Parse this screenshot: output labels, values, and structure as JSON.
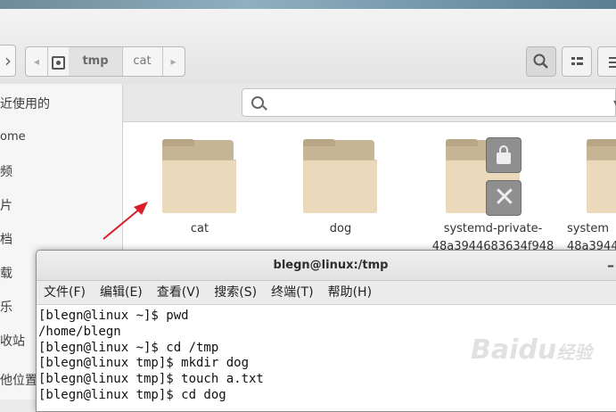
{
  "desktop": {
    "top_label": ""
  },
  "pathbar": {
    "segments": [
      "tmp",
      "cat"
    ]
  },
  "search": {
    "placeholder": ""
  },
  "sidebar": {
    "items": [
      "近使用的",
      "ome",
      "频",
      "片",
      "档",
      "载",
      "乐",
      "收站",
      "他位置"
    ]
  },
  "files": [
    {
      "name": "cat"
    },
    {
      "name": "dog"
    },
    {
      "name": "systemd-private-",
      "name_line2": "48a3944683634f948"
    },
    {
      "name": "system",
      "name_line2": "48a3944"
    }
  ],
  "terminal": {
    "title": "blegn@linux:/tmp",
    "menu": [
      "文件(F)",
      "编辑(E)",
      "查看(V)",
      "搜索(S)",
      "终端(T)",
      "帮助(H)"
    ],
    "lines": [
      "[blegn@linux ~]$ pwd",
      "/home/blegn",
      "[blegn@linux ~]$ cd /tmp",
      "[blegn@linux tmp]$ mkdir dog",
      "[blegn@linux tmp]$ touch a.txt",
      "[blegn@linux tmp]$ cd dog"
    ]
  },
  "watermark": {
    "text": "Baidu",
    "sub": "经验"
  },
  "colors": {
    "folder_body": "#ead9bb",
    "folder_tab": "#c6b595",
    "arrow": "#d9202a"
  }
}
